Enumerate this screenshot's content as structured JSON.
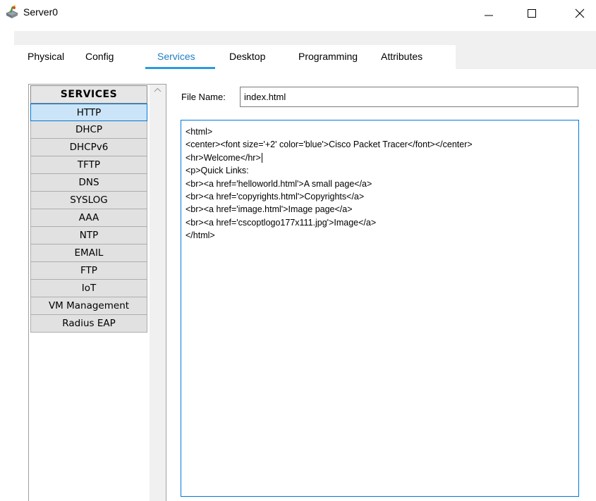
{
  "window": {
    "title": "Server0",
    "icon": "server-app-icon",
    "controls": [
      "minimize-icon",
      "maximize-icon",
      "close-icon"
    ]
  },
  "tabs": [
    {
      "label": "Physical",
      "active": false
    },
    {
      "label": "Config",
      "active": false
    },
    {
      "label": "Services",
      "active": true
    },
    {
      "label": "Desktop",
      "active": false
    },
    {
      "label": "Programming",
      "active": false
    },
    {
      "label": "Attributes",
      "active": false
    }
  ],
  "services": {
    "header": "SERVICES",
    "selected": "HTTP",
    "items": [
      "HTTP",
      "DHCP",
      "DHCPv6",
      "TFTP",
      "DNS",
      "SYSLOG",
      "AAA",
      "NTP",
      "EMAIL",
      "FTP",
      "IoT",
      "VM Management",
      "Radius EAP"
    ]
  },
  "http": {
    "file_name_label": "File Name:",
    "file_name_value": "index.html",
    "content_lines": [
      "<html>",
      "<center><font size='+2' color='blue'>Cisco Packet Tracer</font></center>",
      "<hr>Welcome</hr>",
      "<p>Quick Links:",
      "<br><a href='helloworld.html'>A small page</a>",
      "<br><a href='copyrights.html'>Copyrights</a>",
      "<br><a href='image.html'>Image page</a>",
      "<br><a href='cscoptlogo177x111.jpg'>Image</a>",
      "</html>"
    ]
  },
  "colors": {
    "active_tab": "#1e7fc4",
    "tab_underline": "#2a9be0",
    "selected_item": "#cce4f7",
    "focus_border": "#0078d7"
  }
}
